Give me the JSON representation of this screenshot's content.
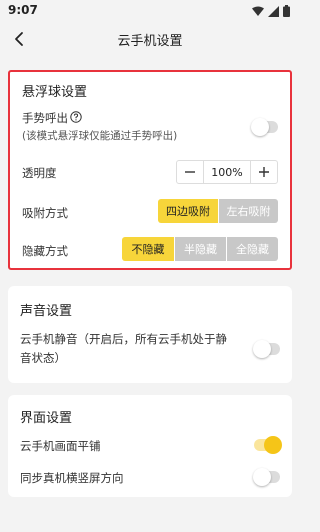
{
  "status_bar": {
    "time": "9:07"
  },
  "header": {
    "title": "云手机设置"
  },
  "floating_ball": {
    "title": "悬浮球设置",
    "gesture_label": "手势呼出",
    "gesture_note": "(该模式悬浮球仅能通过手势呼出)",
    "gesture_on": false,
    "opacity_label": "透明度",
    "opacity_value": "100%",
    "attach_label": "吸附方式",
    "attach_options": [
      "四边吸附",
      "左右吸附"
    ],
    "attach_selected": 0,
    "hide_label": "隐藏方式",
    "hide_options": [
      "不隐藏",
      "半隐藏",
      "全隐藏"
    ],
    "hide_selected": 0
  },
  "sound": {
    "title": "声音设置",
    "mute_label_line1": "云手机静音（开启后，所有云手机处于静",
    "mute_label_line2": "音状态）",
    "mute_on": false
  },
  "display": {
    "title": "界面设置",
    "tile_label": "云手机画面平铺",
    "tile_on": true,
    "sync_label": "同步真机横竖屏方向",
    "sync_on": false
  },
  "colors": {
    "accent": "#f7d53a",
    "highlight_border": "#e8323c",
    "inactive_option": "#c8c8c8"
  }
}
